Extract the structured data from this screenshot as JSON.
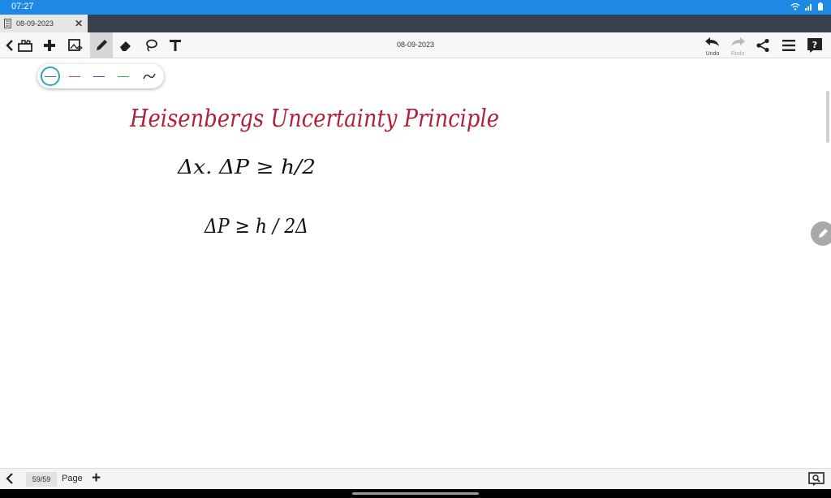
{
  "status_bar": {
    "time": "07:27"
  },
  "tab": {
    "title": "08-09-2023",
    "close_glyph": "✕"
  },
  "toolbar": {
    "title": "08-09-2023",
    "tools": [
      "back-icon",
      "toolbox-icon",
      "add-icon",
      "insert-image-icon",
      "pen-icon",
      "eraser-icon",
      "lasso-icon",
      "text-icon"
    ],
    "undo_label": "Undo",
    "redo_label": "Redo",
    "right_icons": [
      "share-icon",
      "menu-icon",
      "help-icon"
    ]
  },
  "pen_palette": {
    "colors": [
      "#3a6e8c",
      "#c0504d",
      "#3d55a8",
      "#4caf50"
    ],
    "selected_index": 0,
    "extra_icon": "curve-stroke-icon"
  },
  "handwriting": {
    "title": "Heisenbergs Uncertainty Principle",
    "line1": "Δx. ΔP ≥ h/2",
    "line2": "ΔP ≥ h / 2Δ",
    "title_color": "#b0203a",
    "math_color": "#111111"
  },
  "bottom_bar": {
    "page_counter": "59/59",
    "page_label": "Page",
    "add_glyph": "+"
  },
  "colors": {
    "status_bar": "#1e88e5",
    "tab_bar": "#37414f",
    "selected_ring": "#29a8c4"
  }
}
